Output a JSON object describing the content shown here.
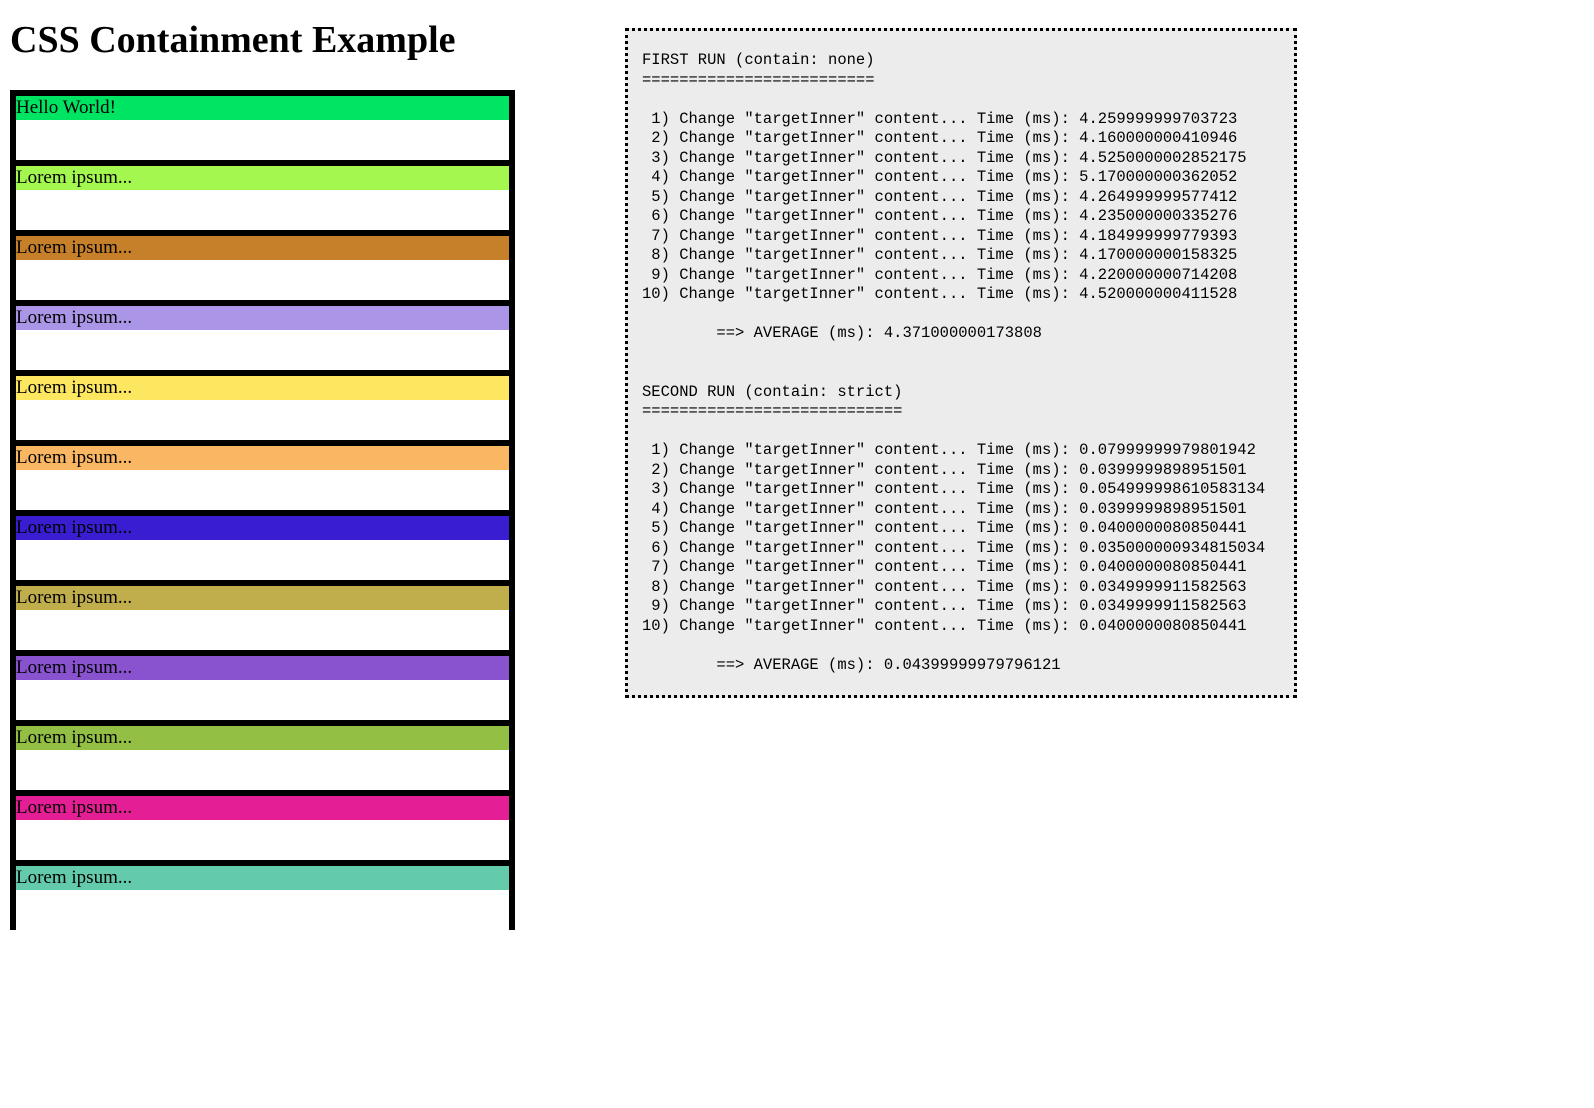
{
  "title": "CSS Containment Example",
  "boxes": [
    {
      "label": "Hello World!",
      "color": "#00e463"
    },
    {
      "label": "Lorem ipsum...",
      "color": "#a4f74f"
    },
    {
      "label": "Lorem ipsum...",
      "color": "#c7802a"
    },
    {
      "label": "Lorem ipsum...",
      "color": "#ab95e7"
    },
    {
      "label": "Lorem ipsum...",
      "color": "#fde760"
    },
    {
      "label": "Lorem ipsum...",
      "color": "#f9b763"
    },
    {
      "label": "Lorem ipsum...",
      "color": "#381ed0"
    },
    {
      "label": "Lorem ipsum...",
      "color": "#c0ad4c"
    },
    {
      "label": "Lorem ipsum...",
      "color": "#8953d0"
    },
    {
      "label": "Lorem ipsum...",
      "color": "#92bf44"
    },
    {
      "label": "Lorem ipsum...",
      "color": "#e41f95"
    },
    {
      "label": "Lorem ipsum...",
      "color": "#63cbac"
    }
  ],
  "output": {
    "label_prefix_format": " {n}) Change \"targetInner\" content... Time (ms): ",
    "runs": [
      {
        "header": "FIRST RUN (contain: none)",
        "underline": "=========================",
        "entries": [
          "4.259999999703723",
          "4.160000000410946",
          "4.5250000002852175",
          "5.170000000362052",
          "4.264999999577412",
          "4.235000000335276",
          "4.184999999779393",
          "4.170000000158325",
          "4.220000000714208",
          "4.520000000411528"
        ],
        "average_label": "        ==> AVERAGE (ms): ",
        "average": "4.371000000173808"
      },
      {
        "header": "SECOND RUN (contain: strict)",
        "underline": "============================",
        "entries": [
          "0.07999999979801942",
          "0.0399999898951501",
          "0.054999998610583134",
          "0.0399999898951501",
          "0.0400000080850441",
          "0.035000000934815034",
          "0.0400000080850441",
          "0.0349999911582563",
          "0.0349999911582563",
          "0.0400000080850441"
        ],
        "entries_display": [
          "0.07999999979801942",
          "0.0399999898951501",
          "0.054999998610583134",
          "0.0399999898951501",
          "0.0400000080850441",
          "0.035000000934815034",
          "0.0400000080850441",
          "0.0349999911582563",
          "0.0349999911582563",
          "0.0400000080850441"
        ],
        "average_label": "        ==> AVERAGE (ms): ",
        "average": "0.04399999979796121"
      }
    ]
  },
  "output_actual": {
    "run1": {
      "header": "FIRST RUN (contain: none)",
      "underline": "=========================",
      "lines": [
        " 1) Change \"targetInner\" content... Time (ms): 4.259999999703723",
        " 2) Change \"targetInner\" content... Time (ms): 4.160000000410946",
        " 3) Change \"targetInner\" content... Time (ms): 4.5250000002852175",
        " 4) Change \"targetInner\" content... Time (ms): 5.170000000362052",
        " 5) Change \"targetInner\" content... Time (ms): 4.264999999577412",
        " 6) Change \"targetInner\" content... Time (ms): 4.235000000335276",
        " 7) Change \"targetInner\" content... Time (ms): 4.184999999779393",
        " 8) Change \"targetInner\" content... Time (ms): 4.170000000158325",
        " 9) Change \"targetInner\" content... Time (ms): 4.220000000714208",
        "10) Change \"targetInner\" content... Time (ms): 4.520000000411528"
      ],
      "average": "        ==> AVERAGE (ms): 4.371000000173808"
    },
    "run2": {
      "header": "SECOND RUN (contain: strict)",
      "underline": "============================",
      "lines": [
        " 1) Change \"targetInner\" content... Time (ms): 0.07999999979801942",
        " 2) Change \"targetInner\" content... Time (ms): 0.0399999898951501",
        " 3) Change \"targetInner\" content... Time (ms): 0.054999998610583134",
        " 4) Change \"targetInner\" content... Time (ms): 0.0399999898951501",
        " 5) Change \"targetInner\" content... Time (ms): 0.0400000080850441",
        " 6) Change \"targetInner\" content... Time (ms): 0.035000000934815034",
        " 7) Change \"targetInner\" content... Time (ms): 0.0400000080850441",
        " 8) Change \"targetInner\" content... Time (ms): 0.0349999911582563",
        " 9) Change \"targetInner\" content... Time (ms): 0.0349999911582563",
        "10) Change \"targetInner\" content... Time (ms): 0.0400000080850441"
      ],
      "average": "        ==> AVERAGE (ms): 0.04399999979796121"
    }
  }
}
